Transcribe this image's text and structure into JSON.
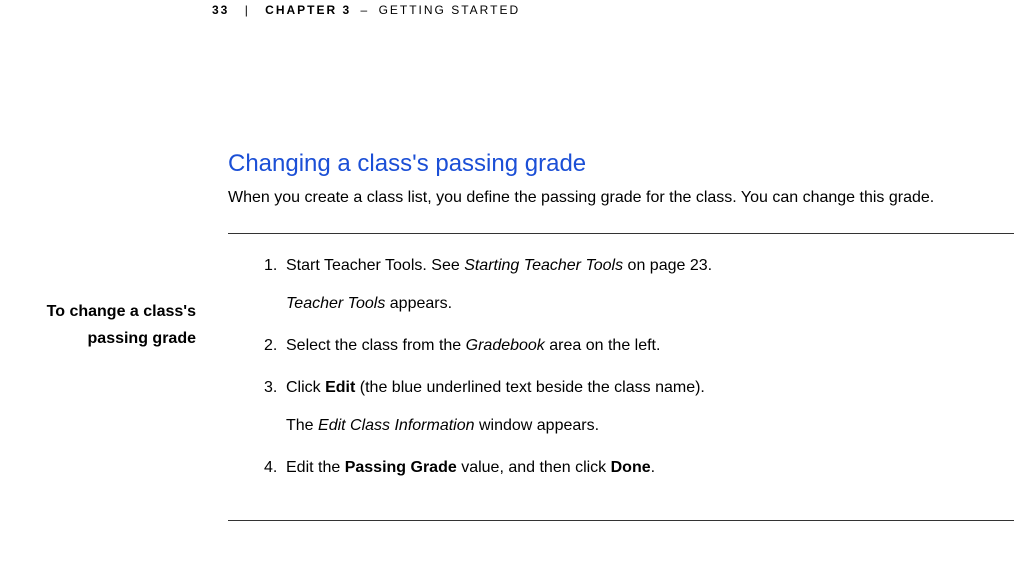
{
  "header": {
    "page_number": "33",
    "separator": "|",
    "chapter_label": "CHAPTER 3",
    "chapter_dash": "–",
    "chapter_title": "GETTING STARTED"
  },
  "section": {
    "heading": "Changing a class's passing grade",
    "intro": "When you create a class list, you define the passing grade for the class. You can change this grade."
  },
  "procedure": {
    "side_label_line1": "To change a class's",
    "side_label_line2": "passing grade",
    "steps": [
      {
        "num": "1.",
        "parts": [
          {
            "text": "Start Teacher Tools. See ",
            "style": ""
          },
          {
            "text": "Starting Teacher Tools",
            "style": "ital"
          },
          {
            "text": " on page 23.",
            "style": ""
          }
        ],
        "sub_parts": [
          {
            "text": "Teacher Tools",
            "style": "ital"
          },
          {
            "text": " appears.",
            "style": ""
          }
        ]
      },
      {
        "num": "2.",
        "parts": [
          {
            "text": "Select the class from the ",
            "style": ""
          },
          {
            "text": "Gradebook",
            "style": "ital"
          },
          {
            "text": " area on the left.",
            "style": ""
          }
        ]
      },
      {
        "num": "3.",
        "parts": [
          {
            "text": "Click ",
            "style": ""
          },
          {
            "text": "Edit",
            "style": "bold"
          },
          {
            "text": " (the blue underlined text beside the class name).",
            "style": ""
          }
        ],
        "sub_parts": [
          {
            "text": "The ",
            "style": ""
          },
          {
            "text": "Edit Class Information",
            "style": "ital"
          },
          {
            "text": " window appears.",
            "style": ""
          }
        ]
      },
      {
        "num": "4.",
        "parts": [
          {
            "text": "Edit the ",
            "style": ""
          },
          {
            "text": "Passing Grade",
            "style": "bold"
          },
          {
            "text": " value, and then click ",
            "style": ""
          },
          {
            "text": "Done",
            "style": "bold"
          },
          {
            "text": ".",
            "style": ""
          }
        ]
      }
    ]
  }
}
